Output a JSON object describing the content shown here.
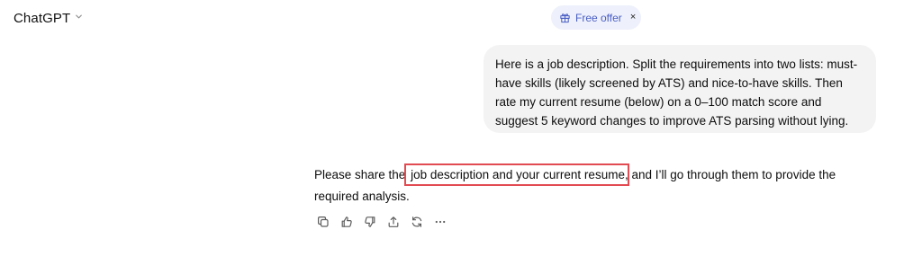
{
  "header": {
    "model_name": "ChatGPT",
    "offer": {
      "label": "Free offer",
      "close": "×"
    }
  },
  "conversation": {
    "user_message": "Here is a job description. Split the requirements into two lists: must-have skills (likely screened by ATS) and nice-to-have skills. Then rate my current resume (below) on a 0–100 match score and suggest 5 keyword changes to improve ATS parsing without lying.",
    "assistant_message": {
      "before": "Please share the ",
      "highlight": "job description and your current resume",
      "after": ", and I’ll go through them to provide the required analysis."
    }
  },
  "actions": [
    {
      "icon": "copy-icon"
    },
    {
      "icon": "thumbs-up-icon"
    },
    {
      "icon": "thumbs-down-icon"
    },
    {
      "icon": "share-icon"
    },
    {
      "icon": "regenerate-icon"
    },
    {
      "icon": "more-icon"
    }
  ],
  "colors": {
    "offer_bg": "#eef0fb",
    "offer_text": "#4a5fc4",
    "bubble_bg": "#f3f3f3",
    "highlight_box": "#e24b52"
  }
}
